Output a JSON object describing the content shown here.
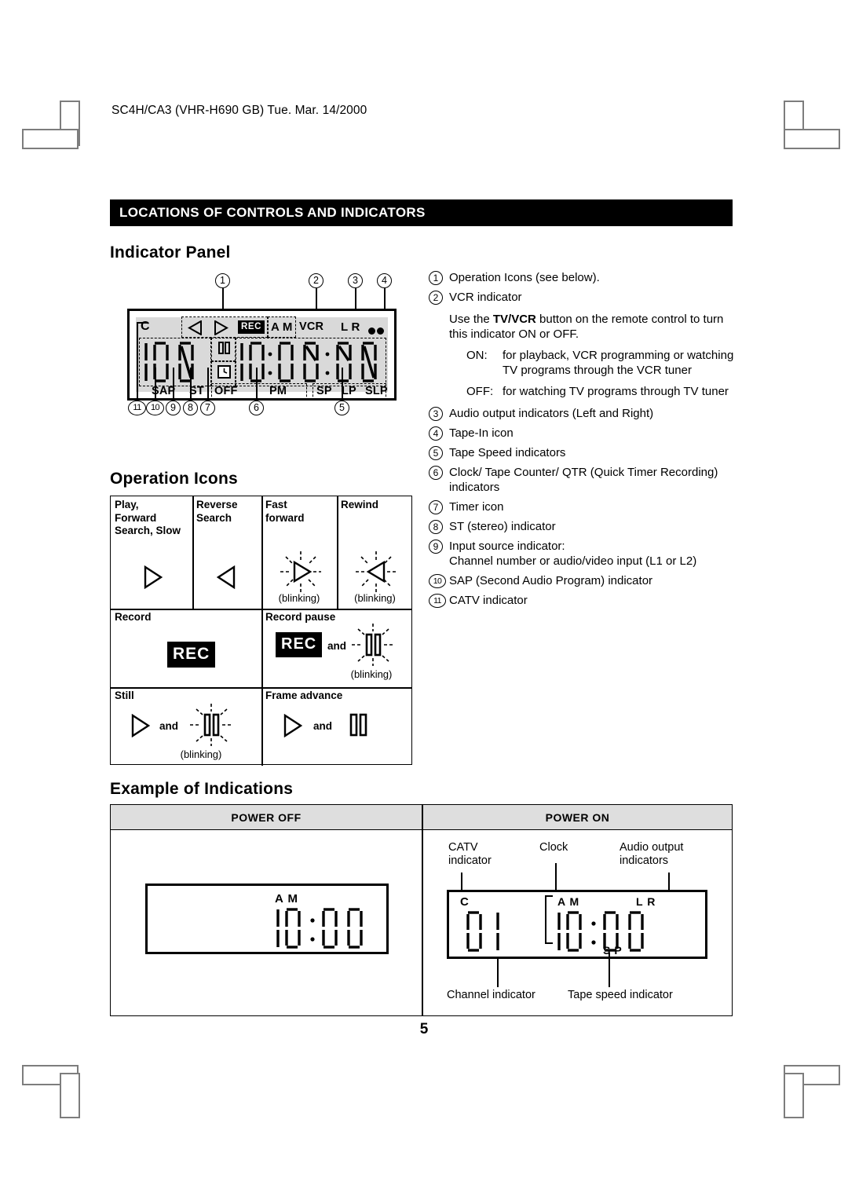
{
  "doc": {
    "header_line": "SC4H/CA3 (VHR-H690 GB) Tue. Mar. 14/2000",
    "page_number": "5",
    "section_title": "LOCATIONS OF CONTROLS AND INDICATORS"
  },
  "headings": {
    "indicator_panel": "Indicator Panel",
    "operation_icons": "Operation Icons",
    "example_of_indications": "Example of Indications"
  },
  "indicator_panel": {
    "callouts_top": [
      "1",
      "2",
      "3",
      "4"
    ],
    "callouts_bottom": [
      "11",
      "10",
      "9",
      "8",
      "7",
      "6",
      "5"
    ],
    "lcd_labels": {
      "catv": "C",
      "rec": "REC",
      "am": "A M",
      "vcr": "VCR",
      "lr": "L R",
      "sap": "SAP",
      "st": "ST",
      "off": "OFF",
      "pm": "PM",
      "sp": "SP",
      "lp": "LP",
      "slp": "SLP"
    },
    "icons": {
      "reverse": "reverse-triangle-icon",
      "play": "play-triangle-icon",
      "pause": "pause-icon",
      "timer": "timer-clock-icon",
      "tape_in": "tape-in-dots-icon"
    }
  },
  "operation_icons": {
    "rows": [
      {
        "cells": [
          {
            "label": "Play,\nForward\nSearch, Slow",
            "icon": "play-triangle-icon",
            "note": ""
          },
          {
            "label": "Reverse\nSearch",
            "icon": "reverse-triangle-icon",
            "note": ""
          },
          {
            "label": "Fast\nforward",
            "icon": "play-triangle-blink-icon",
            "note": "(blinking)"
          },
          {
            "label": "Rewind",
            "icon": "reverse-triangle-blink-icon",
            "note": "(blinking)"
          }
        ]
      },
      {
        "cells": [
          {
            "label": "Record",
            "icon": "rec-badge-icon",
            "note": ""
          },
          {
            "label": "Record pause",
            "icon": "rec-badge-and-pause-blink-icon",
            "note": "(blinking)",
            "conjunction": "and"
          }
        ]
      },
      {
        "cells": [
          {
            "label": "Still",
            "icon": "play-and-pause-blink-icon",
            "note": "(blinking)",
            "conjunction": "and"
          },
          {
            "label": "Frame advance",
            "icon": "play-and-pause-icon",
            "note": "",
            "conjunction": "and"
          }
        ]
      }
    ],
    "rec_label": "REC",
    "and_label": "and",
    "blinking_label": "(blinking)"
  },
  "legend": [
    {
      "num": "1",
      "text": "Operation Icons (see below)."
    },
    {
      "num": "2",
      "text": "VCR indicator",
      "paragraph_pre": "Use the ",
      "paragraph_bold": "TV/VCR",
      "paragraph_post": " button on the remote control to turn this indicator ON or OFF.",
      "on_key": "ON:",
      "on_val": "for playback, VCR programming or watching TV programs through the VCR tuner",
      "off_key": "OFF:",
      "off_val": "for watching TV programs through TV tuner"
    },
    {
      "num": "3",
      "text": "Audio output indicators (Left and Right)"
    },
    {
      "num": "4",
      "text": "Tape-In icon"
    },
    {
      "num": "5",
      "text": "Tape Speed indicators"
    },
    {
      "num": "6",
      "text": "Clock/ Tape Counter/ QTR (Quick Timer Recording) indicators"
    },
    {
      "num": "7",
      "text": "Timer icon"
    },
    {
      "num": "8",
      "text": "ST (stereo) indicator"
    },
    {
      "num": "9",
      "text": "Input source indicator:\nChannel number or audio/video input (L1 or L2)"
    },
    {
      "num": "10",
      "text": "SAP (Second Audio Program) indicator"
    },
    {
      "num": "11",
      "text": "CATV indicator"
    }
  ],
  "example": {
    "col_power_off": "POWER OFF",
    "col_power_on": "POWER ON",
    "power_off_display": {
      "am": "A M",
      "time": "10:00"
    },
    "power_on_display": {
      "catv": "C",
      "channel": "01",
      "am": "A M",
      "lr": "L R",
      "time": "10:00",
      "sp": "S P"
    },
    "annotations": {
      "catv": "CATV\nindicator",
      "clock": "Clock",
      "audio": "Audio output\nindicators",
      "channel": "Channel indicator",
      "tape_speed": "Tape speed indicator"
    }
  },
  "colors": {
    "lcd_background": "#d9d9d9",
    "title_bar": "#000000",
    "table_header": "#dedede",
    "crop_mark": "#7d7d7d"
  }
}
